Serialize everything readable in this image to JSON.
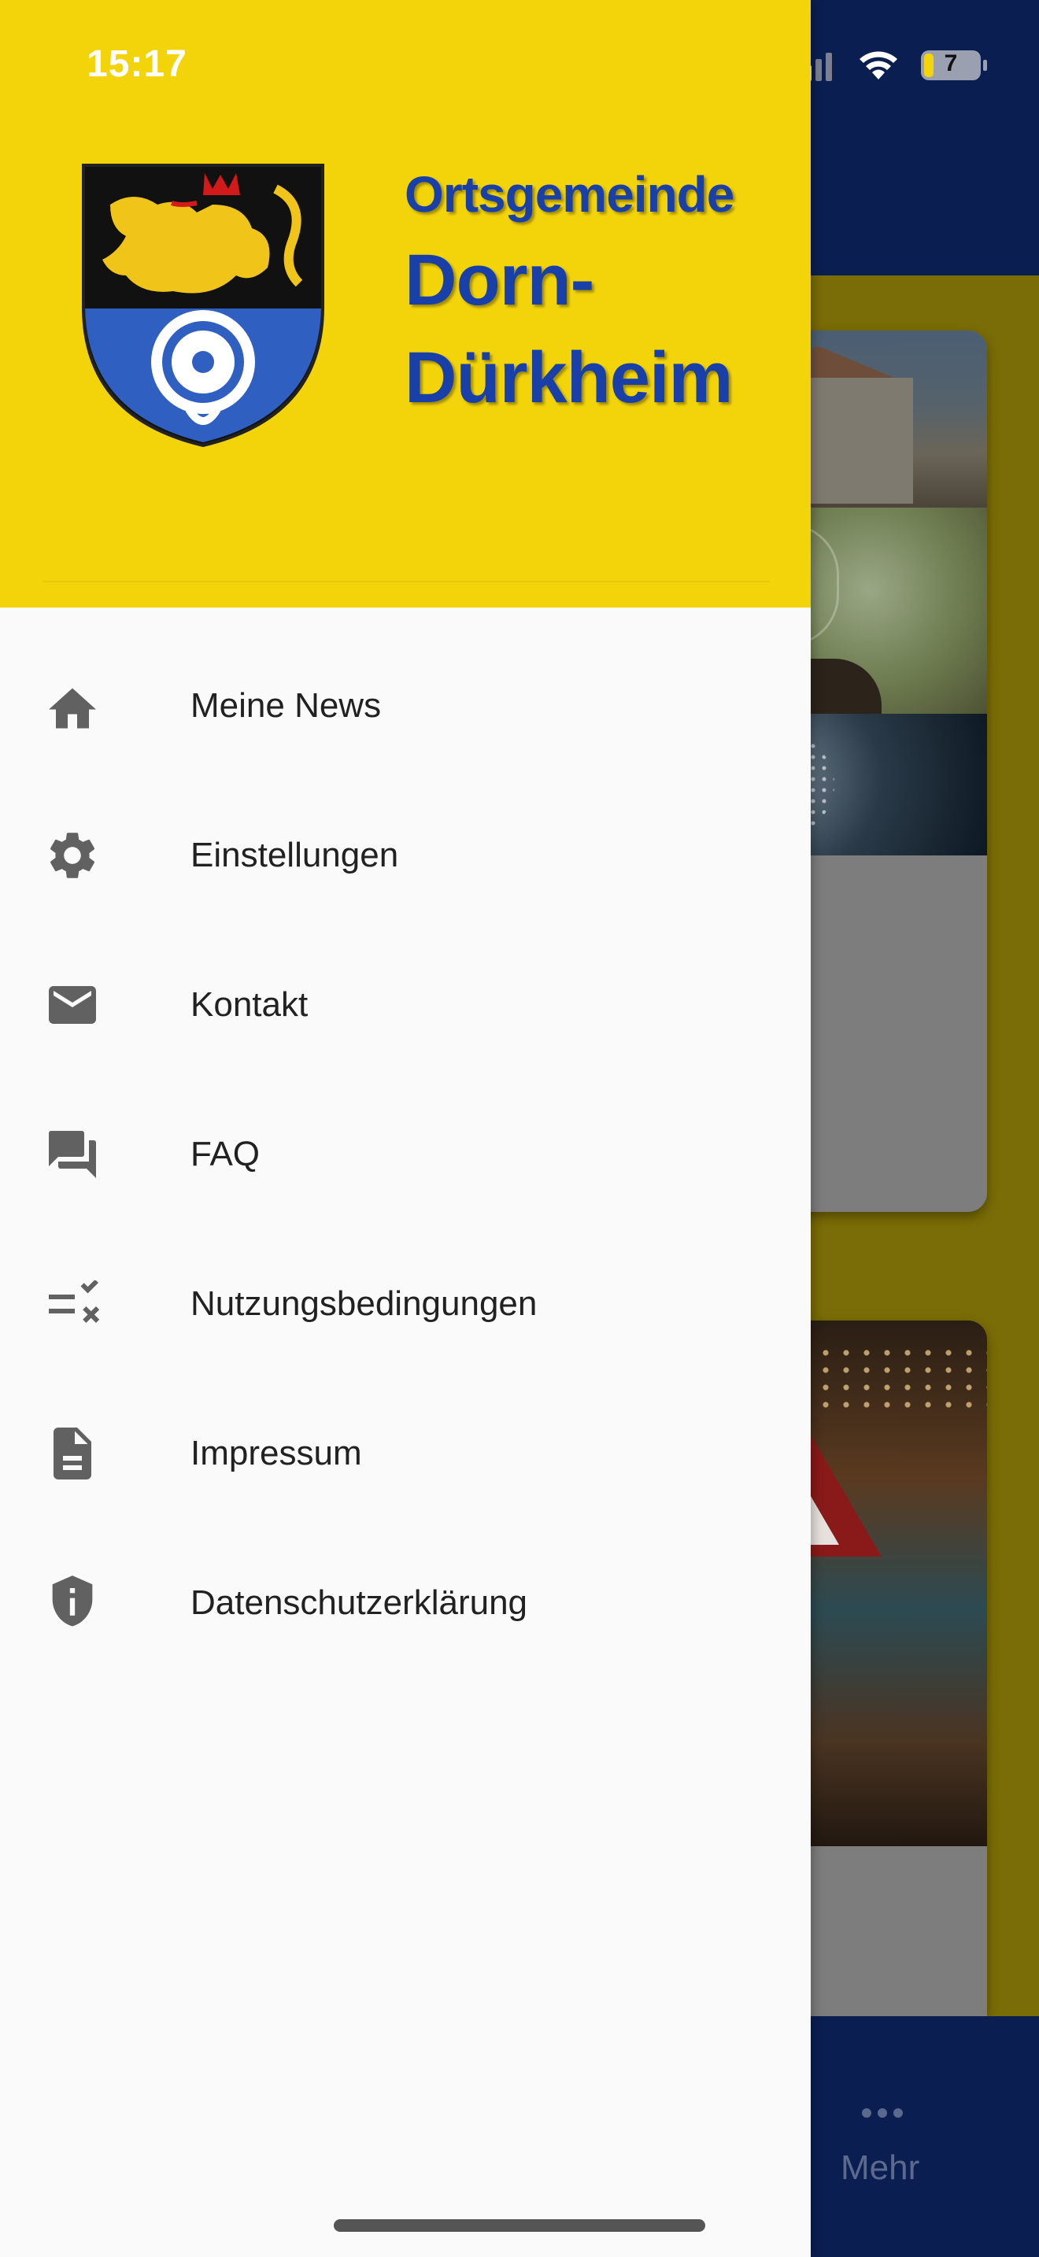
{
  "status_bar": {
    "time": "15:17",
    "battery_level": "7"
  },
  "header": {
    "subtitle": "Ortsgemeinde",
    "title_line1": "Dorn-",
    "title_line2": "Dürkheim"
  },
  "menu": {
    "items": [
      {
        "label": "Meine News",
        "icon": "home-icon"
      },
      {
        "label": "Einstellungen",
        "icon": "gear-icon"
      },
      {
        "label": "Kontakt",
        "icon": "mail-icon"
      },
      {
        "label": "FAQ",
        "icon": "forum-icon"
      },
      {
        "label": "Nutzungsbedingungen",
        "icon": "rule-icon"
      },
      {
        "label": "Impressum",
        "icon": "document-icon"
      },
      {
        "label": "Datenschutzerklärung",
        "icon": "shield-info-icon"
      }
    ]
  },
  "background": {
    "bottom_nav": {
      "more_label": "Mehr"
    }
  },
  "colors": {
    "drawer_header": "#f3d40b",
    "brand_text": "#1840a8",
    "app_bar": "#0a1e52",
    "drawer_bg": "#fafafa",
    "icon": "#616161"
  }
}
